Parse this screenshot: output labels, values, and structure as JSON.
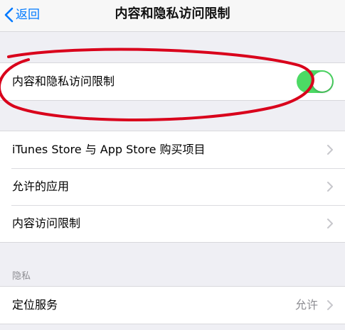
{
  "nav": {
    "back_label": "返回",
    "title": "内容和隐私访问限制"
  },
  "group1": {
    "rows": [
      {
        "label": "内容和隐私访问限制",
        "toggle_on": true
      }
    ]
  },
  "group2": {
    "rows": [
      {
        "label": "iTunes Store 与 App Store 购买项目"
      },
      {
        "label": "允许的应用"
      },
      {
        "label": "内容访问限制"
      }
    ]
  },
  "privacy_section": {
    "header": "隐私",
    "rows": [
      {
        "label": "定位服务",
        "detail": "允许"
      }
    ]
  },
  "colors": {
    "accent": "#007aff",
    "toggle_on": "#4cd964",
    "annotation": "#d9001b",
    "background": "#efeff4"
  },
  "icons": {
    "back": "chevron-left-icon",
    "row_disclosure": "chevron-right-icon"
  }
}
